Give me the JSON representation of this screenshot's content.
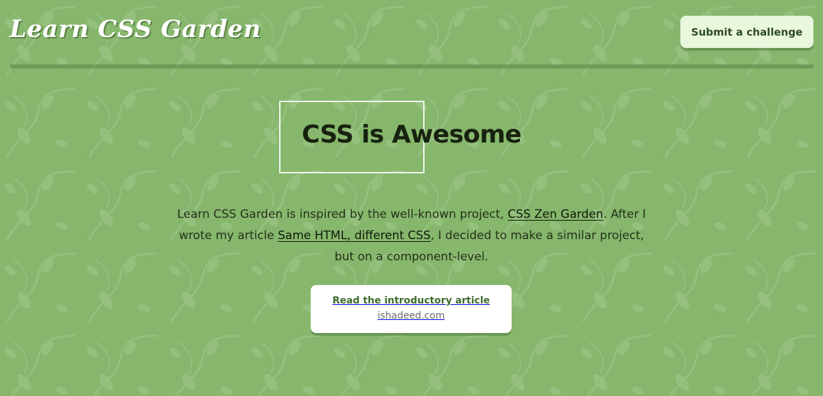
{
  "header": {
    "logo": "Learn CSS Garden",
    "submit_label": "Submit a challenge"
  },
  "hero": {
    "title": "CSS is Awesome"
  },
  "intro": {
    "before_link1": "Learn CSS Garden is inspired by the well-known project, ",
    "link1": "CSS Zen Garden",
    "between_links": ". After I wrote my article ",
    "link2": "Same HTML, different CSS",
    "after_link2": ", I decided to make a similar project, but on a component-level."
  },
  "article_card": {
    "title": "Read the introductory article",
    "source": "ishadeed.com"
  },
  "colors": {
    "background": "#86b76c",
    "card": "#ffffff",
    "button": "#e9f8dc",
    "accent": "#3f6c2c"
  }
}
